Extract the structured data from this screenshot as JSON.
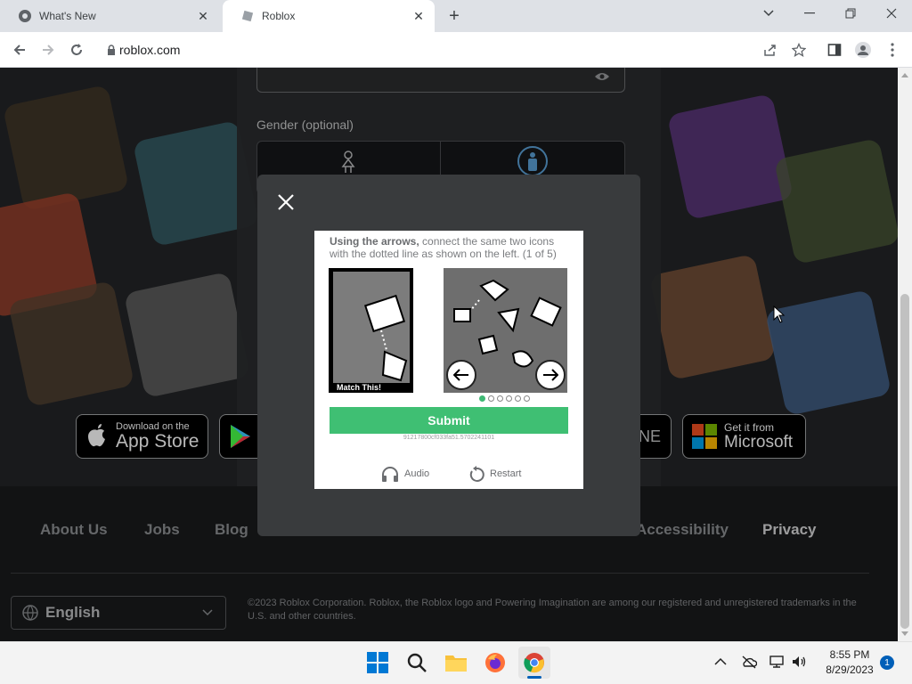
{
  "browser": {
    "tabs": [
      {
        "title": "What's New",
        "active": false
      },
      {
        "title": "Roblox",
        "active": true
      }
    ],
    "url": "roblox.com"
  },
  "page": {
    "gender_label": "Gender (optional)",
    "store_badges": [
      {
        "top": "Download on the",
        "bottom": "App Store"
      },
      {
        "top": "Get it from",
        "bottom": "Microsoft"
      }
    ],
    "footer_links": [
      "About Us",
      "Jobs",
      "Blog",
      "Accessibility",
      "Privacy"
    ],
    "language": "English",
    "copyright": "©2023 Roblox Corporation. Roblox, the Roblox logo and Powering Imagination are among our registered and unregistered trademarks in the U.S. and other countries."
  },
  "captcha": {
    "instruction_bold": "Using the arrows,",
    "instruction_rest": " connect the same two icons with the dotted line as shown on the left. (1 of 5)",
    "match_label": "Match This!",
    "submit_label": "Submit",
    "session_id": "91217800cf033fa51.5702241101",
    "audio_label": "Audio",
    "restart_label": "Restart",
    "progress_current": 1,
    "progress_total": 6
  },
  "taskbar": {
    "time": "8:55 PM",
    "date": "8/29/2023",
    "notification_count": "1"
  },
  "colors": {
    "submit_green": "#3fbf73",
    "page_bg": "#232527",
    "footer_bg": "#191b1d"
  }
}
